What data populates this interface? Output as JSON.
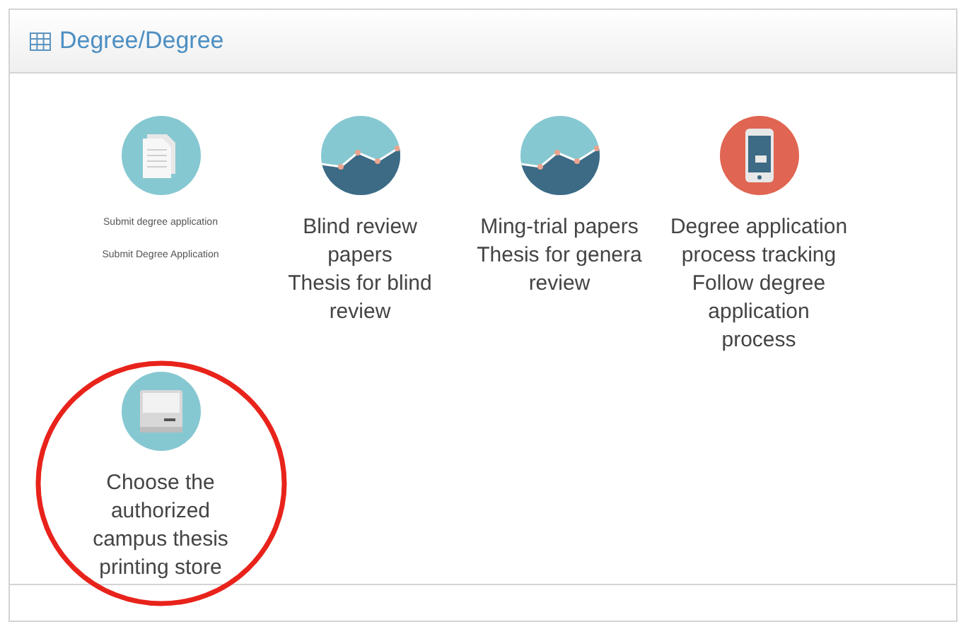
{
  "panel": {
    "title": "Degree/Degree"
  },
  "items": [
    {
      "kind": "document",
      "small_text": true,
      "highlighted": false,
      "title": "Submit degree application",
      "subtitle": "Submit Degree Application"
    },
    {
      "kind": "chart",
      "small_text": false,
      "highlighted": false,
      "title": "Blind review papers",
      "subtitle": "Thesis for blind review"
    },
    {
      "kind": "chart",
      "small_text": false,
      "highlighted": false,
      "title": "Ming-trial papers",
      "subtitle": "Thesis for genera review"
    },
    {
      "kind": "phone",
      "small_text": false,
      "highlighted": false,
      "title": "Degree application process tracking",
      "subtitle": "Follow degree application process"
    },
    {
      "kind": "printer",
      "small_text": false,
      "highlighted": true,
      "title": "Choose the authorized campus thesis printing store"
    }
  ]
}
